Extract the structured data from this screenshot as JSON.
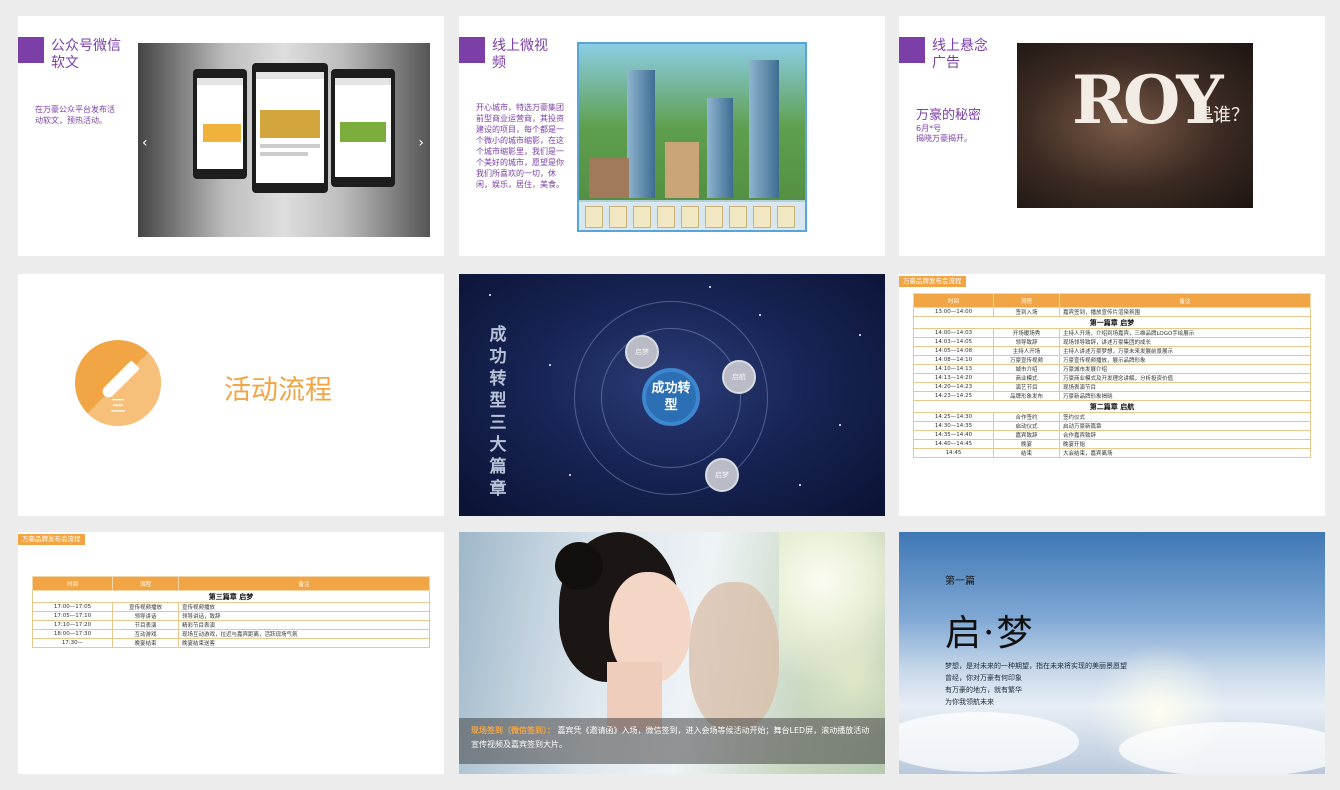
{
  "slide1": {
    "title": "公众号微信软文",
    "body": "在万豪公众平台发布活动软文，预热活动。"
  },
  "slide2": {
    "title": "线上微视频",
    "body": "开心城市，特选万豪集团前型商业运营商，其投资建设的项目，每个都是一个微小的城市缩影，在这个城市缩影里，我们是一个美好的城市，愿望是你我们所喜欢的一切，休闲，娱乐，居住，美食。"
  },
  "slide3": {
    "title": "线上悬念广告",
    "subtitle": "万豪的秘密",
    "body_line1": "6月*号",
    "body_line2": "揭晓万豪揭开。",
    "ad_text": "ROY",
    "ad_question": "是谁？"
  },
  "slide4": {
    "title": "活动流程",
    "icon_glyph": "三"
  },
  "slide5": {
    "vertical_title": "成功转型三大篇章",
    "center_label": "成功转型",
    "nodes": [
      "启梦",
      "启航",
      "启梦"
    ]
  },
  "slide6": {
    "tag": "万豪品牌发布会流程",
    "headers": [
      "时间",
      "流程",
      "备注"
    ],
    "rows": [
      {
        "type": "row",
        "time": "13:00—14:00",
        "step": "签到入场",
        "note": "嘉宾签到，播放宣传片渲染氛围"
      },
      {
        "type": "section",
        "label": "第一篇章  启梦"
      },
      {
        "type": "row",
        "time": "14:00—14:03",
        "step": "开场暖场秀",
        "note": "主持人开场，介绍到场嘉宾，三维品牌LOGO手绘展示"
      },
      {
        "type": "row",
        "time": "14:03—14:05",
        "step": "领导致辞",
        "note": "现场领导致辞，讲述万豪集团的成长"
      },
      {
        "type": "row",
        "time": "14:05—14:08",
        "step": "主持人开场",
        "note": "主持人讲述万豪梦想，万豪未来发展前景展示"
      },
      {
        "type": "row",
        "time": "14:08—14:10",
        "step": "万豪宣传视频",
        "note": "万豪宣传视频播放，展示品牌形象"
      },
      {
        "type": "row",
        "time": "14:10—14:13",
        "step": "城市介绍",
        "note": "万豪城市发展介绍"
      },
      {
        "type": "row",
        "time": "14:13—14:20",
        "step": "商业模式",
        "note": "万豪商业模式及开发理念讲解，分析投资价值"
      },
      {
        "type": "row",
        "time": "14:20—14:23",
        "step": "演艺节目",
        "note": "现场表演节目"
      },
      {
        "type": "row",
        "time": "14:23—14:25",
        "step": "品牌形象发布",
        "note": "万豪新品牌形象揭晓"
      },
      {
        "type": "section",
        "label": "第二篇章  启航"
      },
      {
        "type": "row",
        "time": "14:25—14:30",
        "step": "合作签约",
        "note": "签约仪式"
      },
      {
        "type": "row",
        "time": "14:30—14:35",
        "step": "启动仪式",
        "note": "启动万豪新篇章"
      },
      {
        "type": "row",
        "time": "14:35—14:40",
        "step": "嘉宾致辞",
        "note": "合作嘉宾致辞"
      },
      {
        "type": "row",
        "time": "14:40—14:45",
        "step": "晚宴",
        "note": "晚宴开始"
      },
      {
        "type": "row",
        "time": "14:45",
        "step": "结束",
        "note": "大会结束，嘉宾离场"
      }
    ]
  },
  "slide7": {
    "tag": "万豪品牌发布会流程",
    "headers": [
      "时间",
      "流程",
      "备注"
    ],
    "rows": [
      {
        "type": "section",
        "label": "第三篇章  启梦"
      },
      {
        "type": "row",
        "time": "17:00—17:05",
        "step": "宣传视频播放",
        "note": "宣传视频播放"
      },
      {
        "type": "row",
        "time": "17:05—17:10",
        "step": "领导讲话",
        "note": "领导讲话，致辞"
      },
      {
        "type": "row",
        "time": "17:10—17:20",
        "step": "节目表演",
        "note": "精彩节目表演"
      },
      {
        "type": "row",
        "time": "18:00—17:30",
        "step": "互动游戏",
        "note": "现场互动游戏，拉近与嘉宾距离，活跃现场气氛"
      },
      {
        "type": "row",
        "time": "17:30—",
        "step": "晚宴结束",
        "note": "晚宴结束送客"
      }
    ]
  },
  "slide8": {
    "caption_highlight": "现场签到（微信签到）：",
    "caption_text": "嘉宾凭《邀请函》入场，微信签到，进入会场等候活动开始；舞台LED屏，滚动播放活动宣传视频及嘉宾签到大片。"
  },
  "slide9": {
    "subtitle": "第一篇",
    "title": "启·梦",
    "lines": [
      "梦想，是对未来的一种期望，指在未来将实现的美丽景愿望",
      "曾经，你对万豪有何印象",
      "有万豪的地方，就有繁华",
      "为你我领航未来"
    ]
  }
}
